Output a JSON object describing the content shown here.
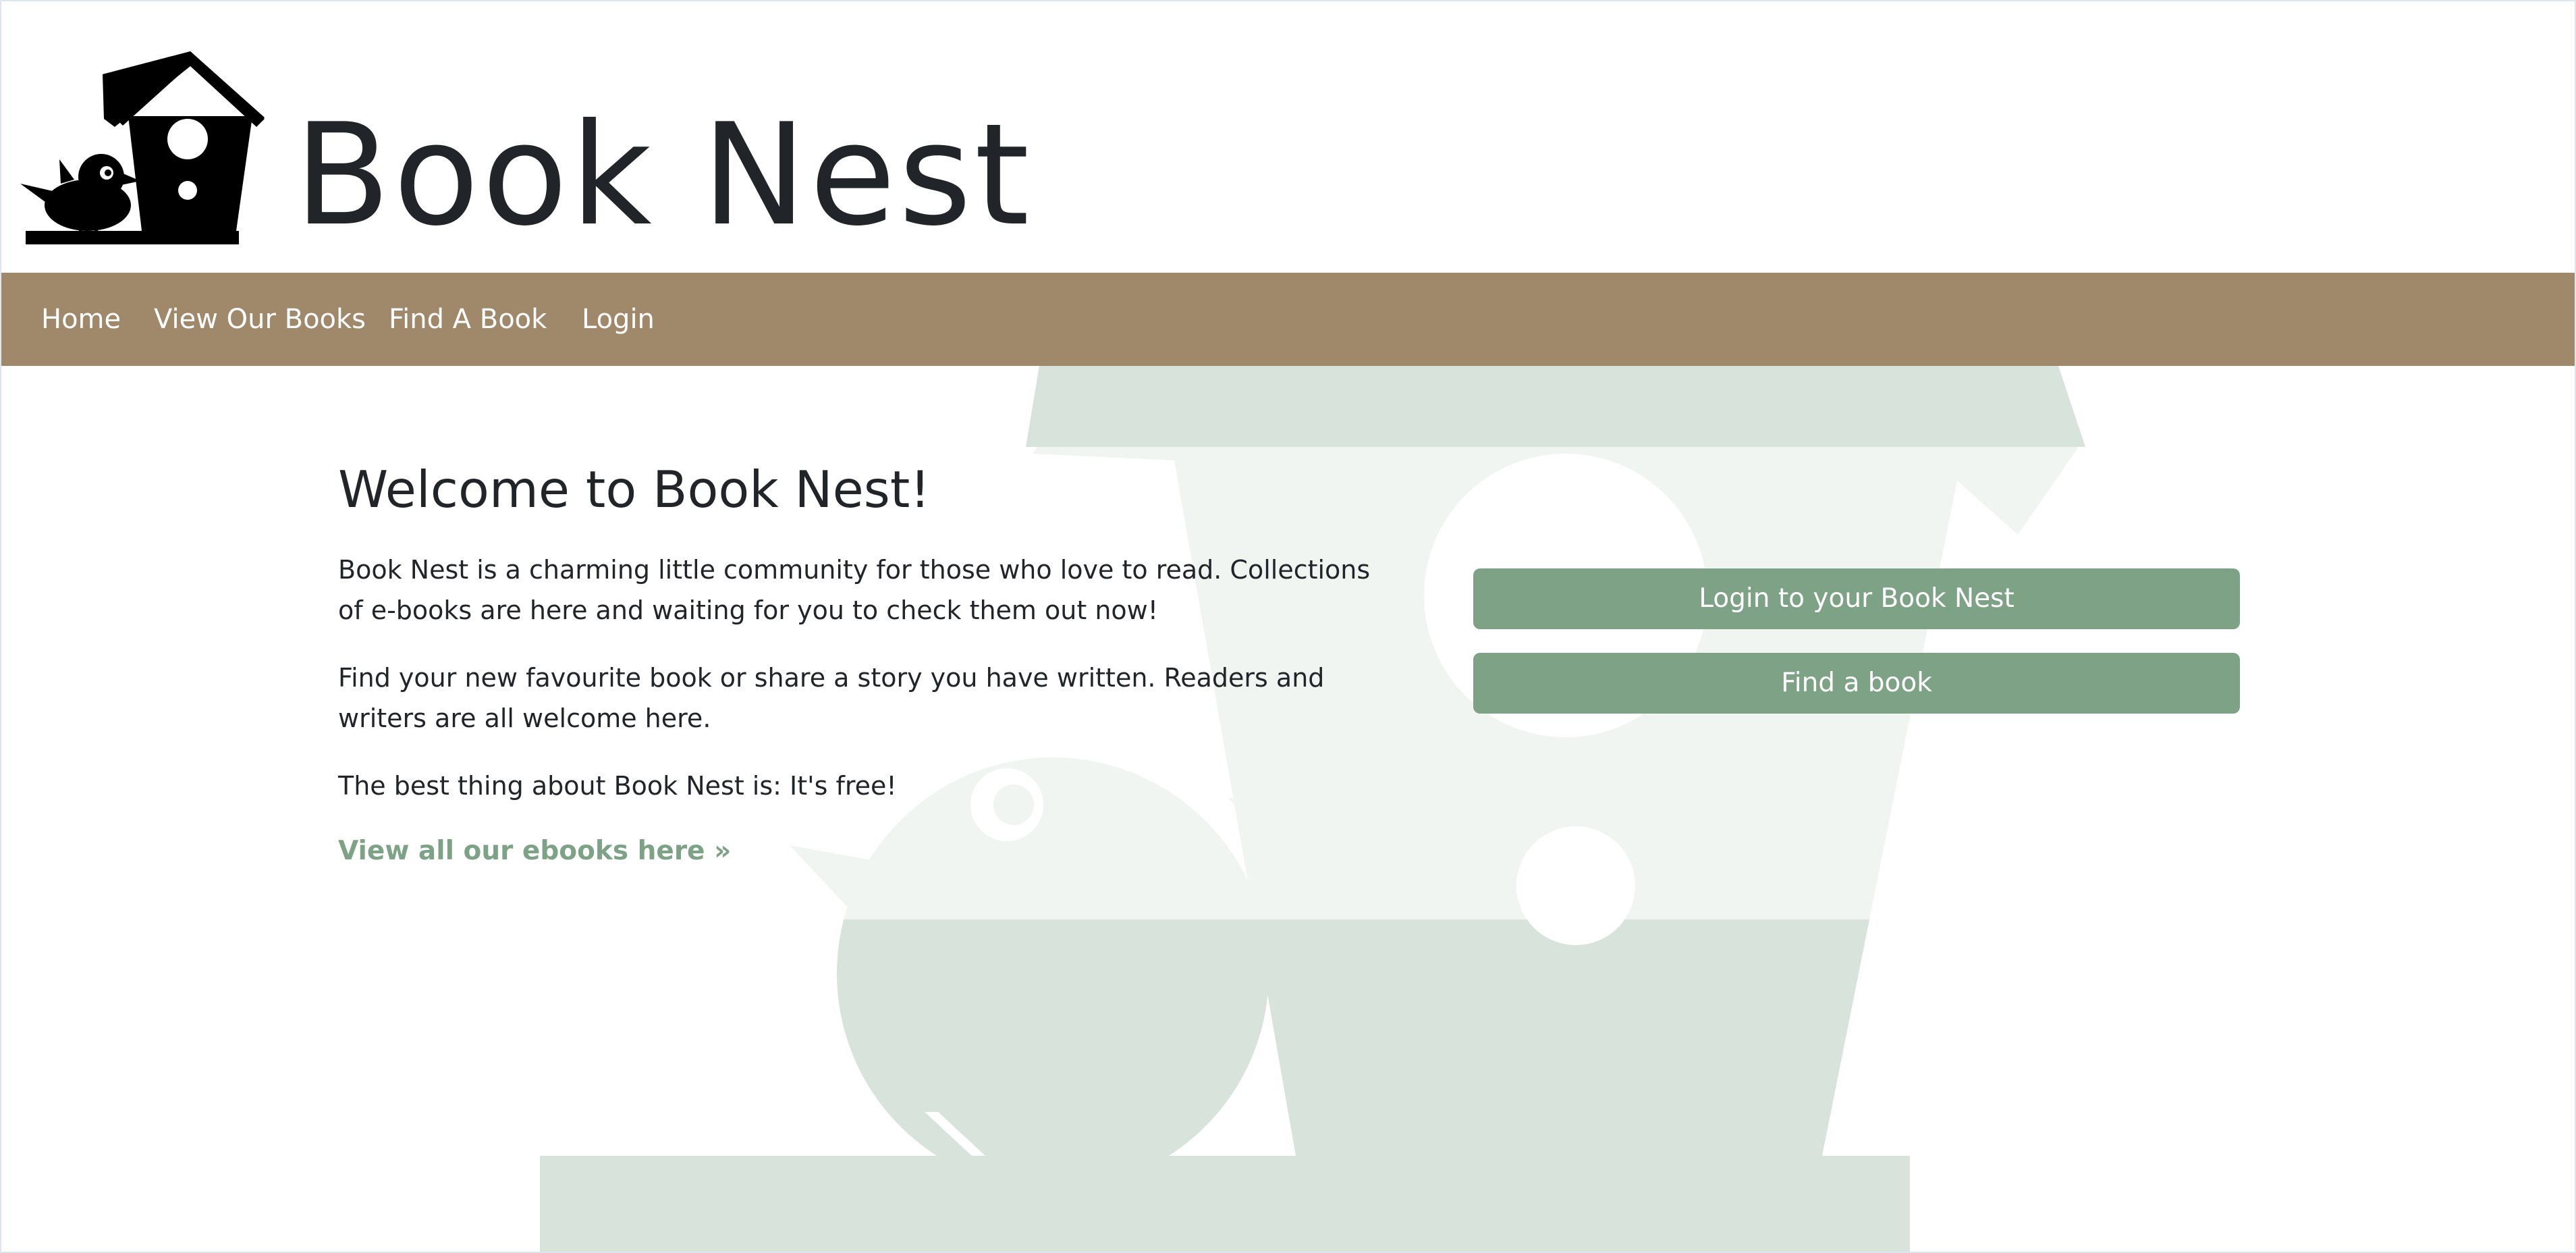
{
  "brand": {
    "name": "Book Nest",
    "logo_icon": "birdhouse-bird-icon"
  },
  "nav": {
    "items": [
      {
        "label": "Home"
      },
      {
        "label": "View Our Books"
      },
      {
        "label": "Find A Book"
      },
      {
        "label": "Login"
      }
    ]
  },
  "main": {
    "title": "Welcome to Book Nest!",
    "paragraphs": [
      "Book Nest is a charming little community for those who love to read. Collections of e-books are here and waiting for you to check them out now!",
      "Find your new favourite book or share a story you have written. Readers and writers are all welcome here.",
      "The best thing about Book Nest is: It's free!"
    ],
    "link_label": "View all our ebooks here »"
  },
  "actions": {
    "login_label": "Login to your Book Nest",
    "find_label": "Find a book"
  },
  "colors": {
    "nav_bg": "#a0896b",
    "accent": "#7ea285",
    "watermark_light": "#f1f5f2",
    "watermark_dark": "#d8e3dc",
    "text": "#212529"
  }
}
